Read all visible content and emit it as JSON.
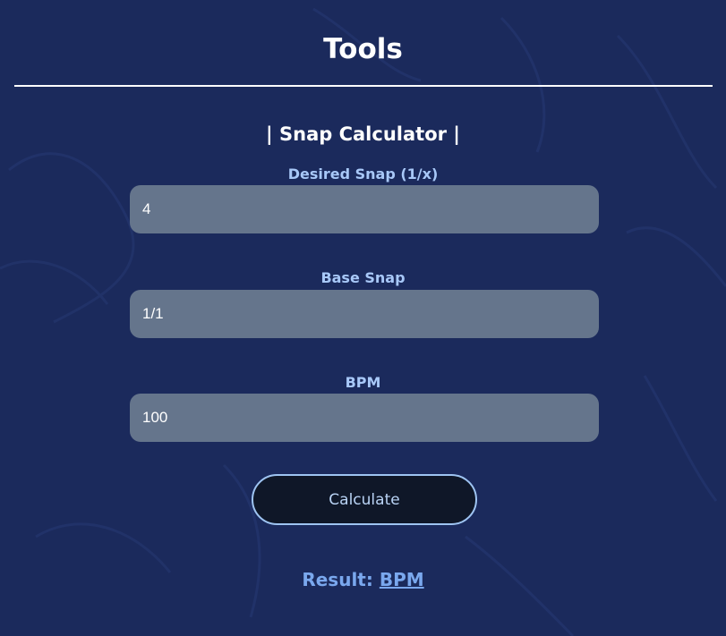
{
  "page": {
    "title": "Tools"
  },
  "snap_calculator": {
    "heading": "| Snap Calculator |",
    "fields": [
      {
        "label": "Desired Snap (1/x)",
        "value": "4"
      },
      {
        "label": "Base Snap",
        "value": "1/1"
      },
      {
        "label": "BPM",
        "value": "100"
      }
    ],
    "calculate_label": "Calculate",
    "result_label": "Result:",
    "result_value": "BPM"
  },
  "colors": {
    "background": "#1b2a5c",
    "input_background": "#65758c",
    "label": "#a8c8f8",
    "result": "#7aa8ee",
    "button_background": "#0f1728",
    "button_border": "#9ec4f2"
  }
}
